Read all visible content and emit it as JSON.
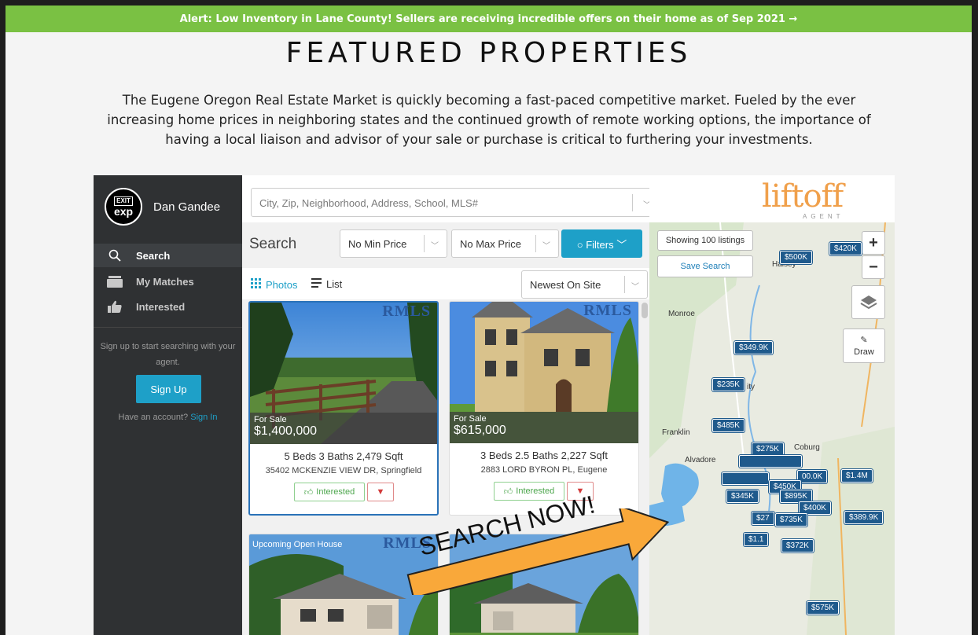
{
  "alert": {
    "text": "Alert: Low Inventory in Lane County! Sellers are receiving incredible offers on their home as of Sep 2021 →"
  },
  "page": {
    "title": "FEATURED PROPERTIES",
    "intro": "The Eugene Oregon Real Estate Market is quickly becoming a fast-paced competitive market. Fueled by the ever increasing home prices in neighboring states and the continued growth of remote working options, the importance of having a local liaison and advisor of your sale or purchase is critical to furthering your investments."
  },
  "sidebar": {
    "logo_top": "EXIT",
    "logo_bottom": "exp",
    "agent_name": "Dan Gandee",
    "items": [
      {
        "label": "Search",
        "icon": "search-icon"
      },
      {
        "label": "My Matches",
        "icon": "matches-icon"
      },
      {
        "label": "Interested",
        "icon": "thumbs-up-icon"
      }
    ],
    "signup_text": "Sign up to start searching with your agent.",
    "signup_button": "Sign Up",
    "have_account": "Have an account?",
    "sign_in": "Sign In"
  },
  "search": {
    "placeholder": "City, Zip, Neighborhood, Address, School, MLS#",
    "label": "Search",
    "min_price": "No Min Price",
    "max_price": "No Max Price",
    "filters": "Filters",
    "view_photos": "Photos",
    "view_list": "List",
    "sort": "Newest On Site"
  },
  "listings": [
    {
      "status": "For Sale",
      "price": "$1,400,000",
      "specs": "5 Beds  3 Baths  2,479 Sqft",
      "address": "35402 MCKENZIE VIEW DR, Springfield",
      "interested": "Interested",
      "brand": "RMLS"
    },
    {
      "status": "For Sale",
      "price": "$615,000",
      "specs": "3 Beds  2.5 Baths  2,227 Sqft",
      "address": "2883 LORD BYRON PL, Eugene",
      "interested": "Interested",
      "brand": "RMLS"
    },
    {
      "status": "Upcoming Open House",
      "brand": "RMLS"
    },
    {
      "status": "",
      "brand": ""
    }
  ],
  "map": {
    "brand": "liftoff",
    "brand_sub": "AGENT",
    "showing": "Showing 100 listings",
    "save_search": "Save Search",
    "zoom_in": "+",
    "zoom_out": "−",
    "draw": "Draw",
    "towns": [
      "Monroe",
      "Franklin",
      "Alvadore",
      "Coburg",
      "Halsey",
      "ity"
    ],
    "pins": [
      "$420K",
      "$500K",
      "$349.9K",
      "$235K",
      "$485K",
      "$1.4M",
      "$345K",
      "$450K",
      "$895K",
      "$400K",
      "$389.9K",
      "$27",
      "$735K",
      "$1.1",
      "$372K",
      "$575K",
      "$275K",
      "00.0K"
    ]
  },
  "overlay": {
    "cta": "SEARCH NOW!"
  },
  "colors": {
    "alert": "#7ac143",
    "accent": "#1ea0c8",
    "pin": "#1f5a8c",
    "cta": "#f9a83a"
  }
}
